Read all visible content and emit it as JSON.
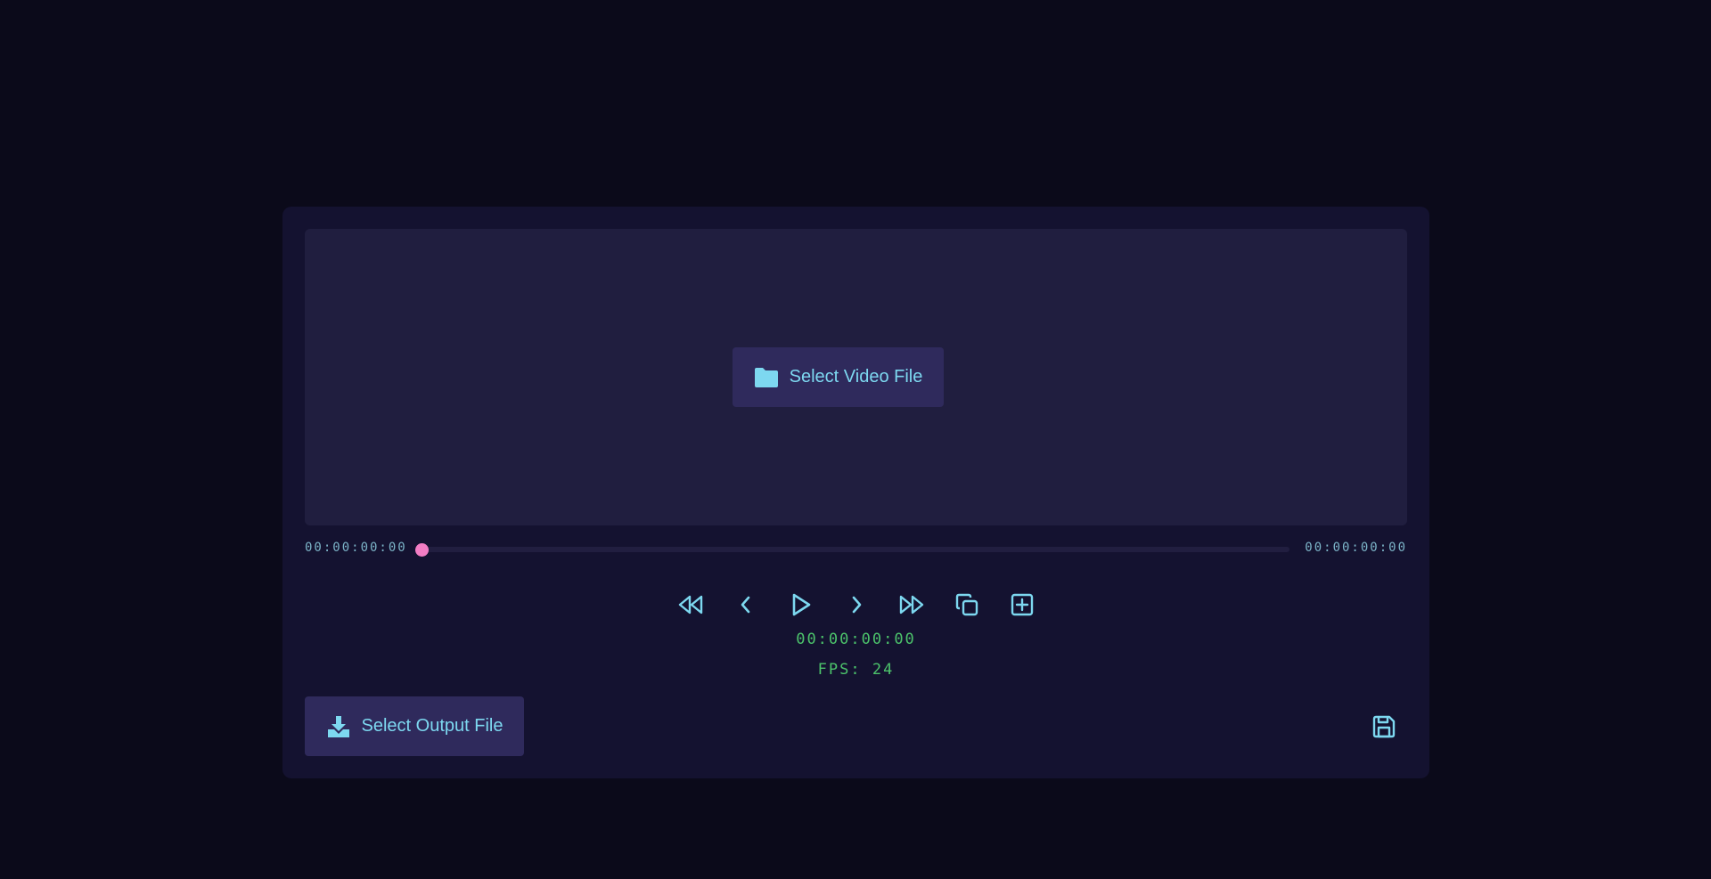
{
  "preview": {
    "select_video_label": "Select Video File",
    "icon": "folder-icon"
  },
  "timeline": {
    "start_timecode": "00:00:00:00",
    "end_timecode": "00:00:00:00",
    "progress": 0
  },
  "controls": [
    {
      "name": "jump-back-button",
      "icon": "double-chevron-left-icon"
    },
    {
      "name": "prev-frame-button",
      "icon": "chevron-left-icon"
    },
    {
      "name": "play-button",
      "icon": "play-icon"
    },
    {
      "name": "next-frame-button",
      "icon": "chevron-right-icon"
    },
    {
      "name": "jump-forward-button",
      "icon": "double-chevron-right-icon"
    },
    {
      "name": "copy-button",
      "icon": "copy-icon"
    },
    {
      "name": "add-button",
      "icon": "plus-square-icon"
    }
  ],
  "status": {
    "current_timecode": "00:00:00:00",
    "fps_label": "FPS: 24"
  },
  "output": {
    "select_output_label": "Select Output File",
    "icon": "download-icon",
    "save_icon": "save-icon"
  },
  "colors": {
    "background": "#0b0a1a",
    "panel": "#141230",
    "accent": "#7dd8f0",
    "timecode_green": "#4cc36b",
    "playhead": "#f27dc4"
  }
}
